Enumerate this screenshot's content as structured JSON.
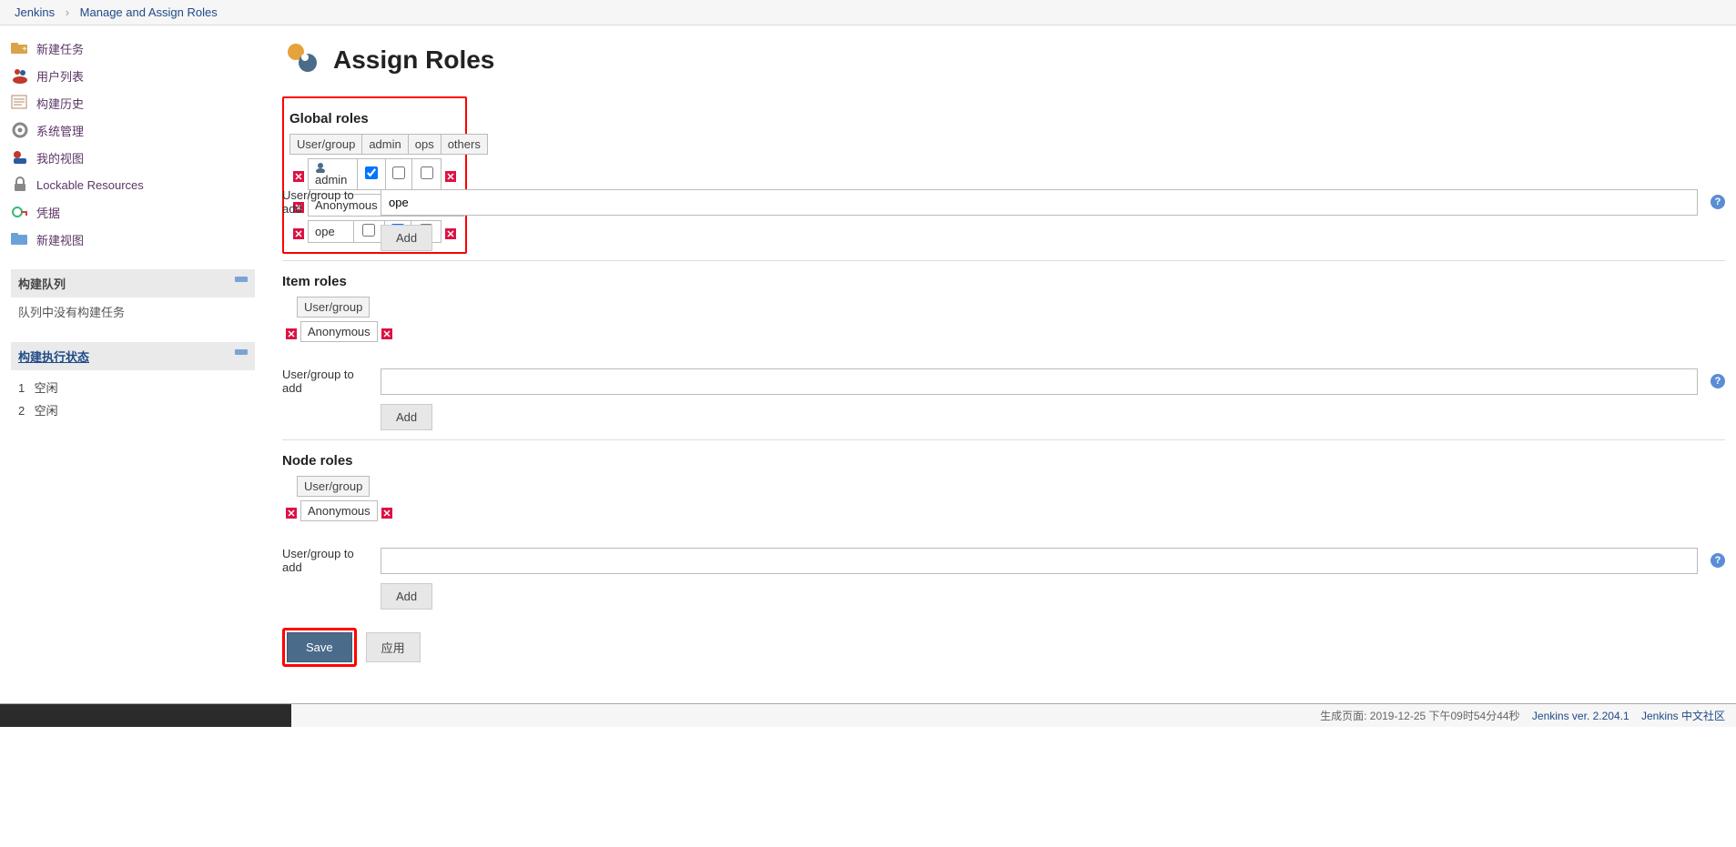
{
  "breadcrumb": {
    "home": "Jenkins",
    "page": "Manage and Assign Roles"
  },
  "sidebar": {
    "items": [
      {
        "label": "新建任务",
        "icon": "new-job"
      },
      {
        "label": "用户列表",
        "icon": "people"
      },
      {
        "label": "构建历史",
        "icon": "history"
      },
      {
        "label": "系统管理",
        "icon": "manage"
      },
      {
        "label": "我的视图",
        "icon": "myview"
      },
      {
        "label": "Lockable Resources",
        "icon": "lock"
      },
      {
        "label": "凭据",
        "icon": "credentials"
      },
      {
        "label": "新建视图",
        "icon": "newview"
      }
    ],
    "queue": {
      "title": "构建队列",
      "empty": "队列中没有构建任务"
    },
    "executors": {
      "title": "构建执行状态",
      "rows": [
        {
          "num": "1",
          "status": "空闲"
        },
        {
          "num": "2",
          "status": "空闲"
        }
      ]
    }
  },
  "main": {
    "title": "Assign Roles",
    "global": {
      "title": "Global roles",
      "headers": [
        "User/group",
        "admin",
        "ops",
        "others"
      ],
      "rows": [
        {
          "name": "admin",
          "icon": true,
          "checks": [
            true,
            false,
            false
          ]
        },
        {
          "name": "Anonymous",
          "icon": false,
          "checks": [
            false,
            false,
            false
          ]
        },
        {
          "name": "ope",
          "icon": false,
          "checks": [
            false,
            true,
            false
          ]
        }
      ],
      "add_label": "User/group to add",
      "add_value": "ope",
      "add_button": "Add"
    },
    "item": {
      "title": "Item roles",
      "headers": [
        "User/group"
      ],
      "rows": [
        {
          "name": "Anonymous"
        }
      ],
      "add_label": "User/group to add",
      "add_value": "",
      "add_button": "Add"
    },
    "node": {
      "title": "Node roles",
      "headers": [
        "User/group"
      ],
      "rows": [
        {
          "name": "Anonymous"
        }
      ],
      "add_label": "User/group to add",
      "add_value": "",
      "add_button": "Add"
    },
    "save": "Save",
    "apply": "应用"
  },
  "footer": {
    "gen": "生成页面: 2019-12-25 下午09时54分44秒",
    "ver": "Jenkins ver. 2.204.1",
    "community": "Jenkins 中文社区"
  }
}
